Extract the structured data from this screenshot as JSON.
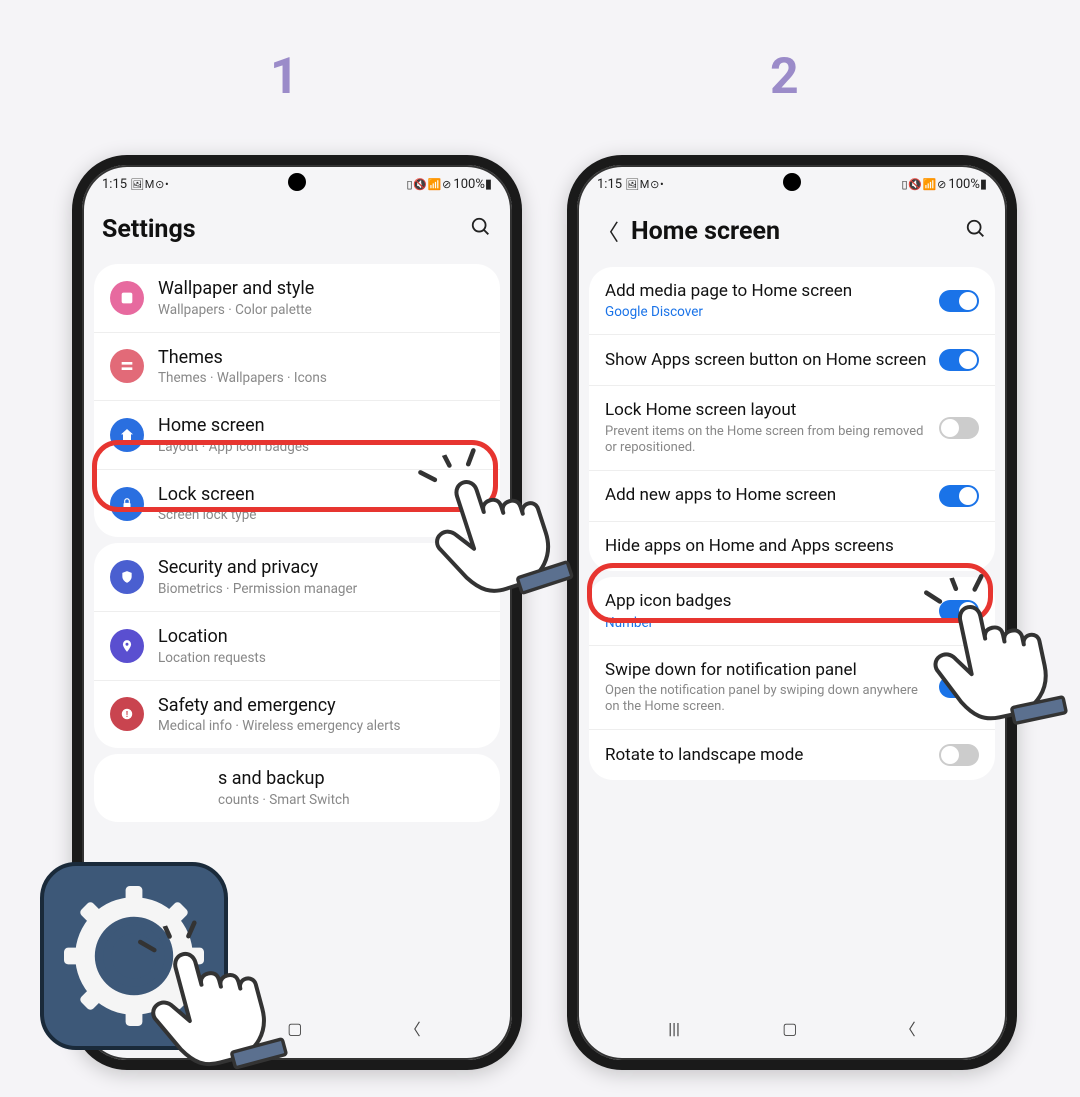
{
  "steps": {
    "one": "1",
    "two": "2"
  },
  "status": {
    "time": "1:15",
    "left_icons": "🖼 M ⊙ •",
    "right_icons": "▯ 🔇 📶 ⊘ ",
    "battery": "100%▮"
  },
  "phone1": {
    "title": "Settings",
    "groups": [
      {
        "items": [
          {
            "icon_color": "#e76a9f",
            "glyph": "🖼",
            "title": "Wallpaper and style",
            "sub": "Wallpapers  ·  Color palette"
          },
          {
            "icon_color": "#e26a78",
            "glyph": "🎨",
            "title": "Themes",
            "sub": "Themes  ·  Wallpapers  ·  Icons"
          },
          {
            "icon_color": "#2a6fe0",
            "glyph": "⌂",
            "title": "Home screen",
            "sub": "Layout  ·  App icon badges"
          },
          {
            "icon_color": "#2a6fe0",
            "glyph": "🔒",
            "title": "Lock screen",
            "sub": "Screen lock type"
          }
        ]
      },
      {
        "items": [
          {
            "icon_color": "#4a5fd0",
            "glyph": "🛡",
            "title": "Security and privacy",
            "sub": "Biometrics  ·  Permission manager"
          },
          {
            "icon_color": "#5a4fd0",
            "glyph": "📍",
            "title": "Location",
            "sub": "Location requests"
          },
          {
            "icon_color": "#c9444f",
            "glyph": "!",
            "title": "Safety and emergency",
            "sub": "Medical info  ·  Wireless emergency alerts"
          }
        ]
      },
      {
        "items": [
          {
            "icon_color": "#888",
            "glyph": "",
            "title": "s and backup",
            "sub": "counts  ·  Smart Switch"
          }
        ]
      }
    ]
  },
  "phone2": {
    "title": "Home screen",
    "groups": [
      {
        "items": [
          {
            "title": "Add media page to Home screen",
            "link": "Google Discover",
            "toggle": "on"
          },
          {
            "title": "Show Apps screen button on Home screen",
            "toggle": "on"
          },
          {
            "title": "Lock Home screen layout",
            "sub": "Prevent items on the Home screen from being removed or repositioned.",
            "toggle": "off"
          },
          {
            "title": "Add new apps to Home screen",
            "toggle": "on"
          },
          {
            "title": "Hide apps on Home and Apps screens"
          }
        ]
      },
      {
        "items": [
          {
            "title": "App icon badges",
            "link": "Number",
            "toggle": "on"
          },
          {
            "title": "Swipe down for notification panel",
            "sub": "Open the notification panel by swiping down anywhere on the Home screen.",
            "toggle": "on"
          },
          {
            "title": "Rotate to landscape mode",
            "toggle": "off"
          }
        ]
      }
    ]
  }
}
